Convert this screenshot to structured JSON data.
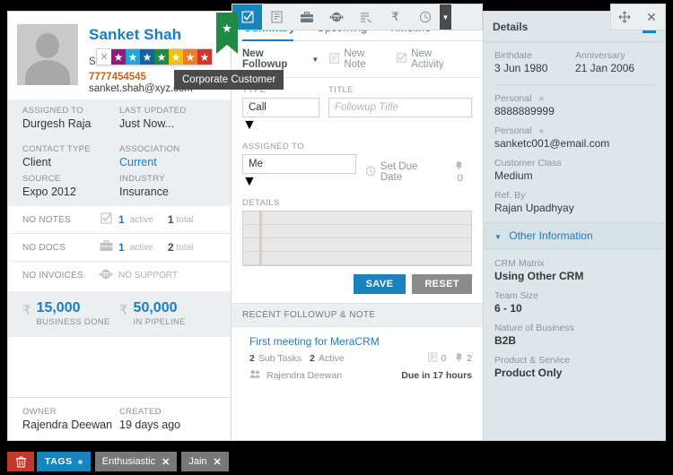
{
  "toolbar": {
    "icons": [
      {
        "name": "activity-icon",
        "glyph": "☑",
        "active": true
      },
      {
        "name": "note-icon",
        "glyph": "Ὕ2"
      },
      {
        "name": "briefcase-icon",
        "glyph": "▬"
      },
      {
        "name": "support-icon",
        "glyph": "☺"
      },
      {
        "name": "invoice-icon",
        "glyph": "≡"
      },
      {
        "name": "rupee-icon",
        "glyph": "₹"
      },
      {
        "name": "history-icon",
        "glyph": "◴"
      }
    ],
    "more_glyph": "▼",
    "move_glyph": "✥",
    "close_glyph": "✕"
  },
  "customer": {
    "name": "Sanket Shah",
    "company": "Shivam Financial Services",
    "phone": "7777454545",
    "email": "sanket.shah@xyz.com",
    "tooltip": "Corporate Customer",
    "rating_clear": "✕",
    "star_glyph": "★",
    "star_colors": [
      "#8e1c78",
      "#1ea7dd",
      "#16629e",
      "#1e8a46",
      "#f2c00f",
      "#f07c23",
      "#d4342b"
    ],
    "ribbon_color": "#1e8a46"
  },
  "left_fields": [
    {
      "label": "ASSIGNED TO",
      "value": "Durgesh Raja",
      "label2": "LAST UPDATED",
      "value2": "Just Now...",
      "band": true
    },
    {
      "label": "CONTACT TYPE",
      "value": "Client",
      "label2": "ASSOCIATION",
      "value2": "Current",
      "link2": true
    },
    {
      "label": "SOURCE",
      "value": "Expo 2012",
      "label2": "INDUSTRY",
      "value2": "Insurance"
    }
  ],
  "stats": [
    {
      "label": "NO NOTES",
      "icon": "note-check-icon",
      "glyph": "☑",
      "num": "1",
      "sub": "active",
      "num2": "1",
      "sub2": "total"
    },
    {
      "label": "NO DOCS",
      "icon": "briefcase-icon",
      "glyph": "▬",
      "num": "1",
      "sub": "active",
      "num2": "2",
      "sub2": "total"
    },
    {
      "label": "NO INVOICES",
      "icon": "support-face-icon",
      "glyph": "☺",
      "num": "",
      "sub": "NO SUPPORT",
      "num2": "",
      "sub2": ""
    }
  ],
  "money": [
    {
      "currency": "₹",
      "amount": "15,000",
      "label": "BUSINESS DONE"
    },
    {
      "currency": "₹",
      "amount": "50,000",
      "label": "IN PIPELINE"
    }
  ],
  "owner": {
    "label": "OWNER",
    "value": "Rajendra Deewan",
    "label2": "CREATED",
    "value2": "19 days ago"
  },
  "tabs": [
    {
      "label": "Summary",
      "selected": true
    },
    {
      "label": "Upcoming",
      "selected": false
    },
    {
      "label": "Timeline",
      "selected": false
    }
  ],
  "actions": [
    {
      "label": "New Followup",
      "glyph": "",
      "caret": "▼",
      "strong": true
    },
    {
      "label": "New Note",
      "glyph": "Ὕ2",
      "caret": "",
      "strong": false
    },
    {
      "label": "New Activity",
      "glyph": "☑",
      "caret": "",
      "strong": false
    }
  ],
  "form": {
    "type_label": "TYPE",
    "type_value": "Call",
    "title_label": "TITLE",
    "title_placeholder": "Followup Title",
    "assigned_label": "ASSIGNED TO",
    "assigned_value": "Me",
    "due_date_label": "Set Due Date",
    "clock_glyph": "◴",
    "bell_glyph": "ὑ4",
    "bell_count": "0",
    "details_label": "DETAILS",
    "save_label": "SAVE",
    "reset_label": "RESET",
    "arrow_glyph": "▼"
  },
  "recent": {
    "header": "RECENT FOLLOWUP & NOTE",
    "title": "First meeting for MeraCRM",
    "subtask_count": "2",
    "subtask_label": "Sub Tasks",
    "active_count": "2",
    "active_label": "Active",
    "note_icon_count": "0",
    "bell_icon_count": "2",
    "user": "Rajendra Deewan",
    "due": "Due in 17 hours"
  },
  "details_panel": {
    "title": "Details",
    "add_glyph": "+",
    "pairs": [
      {
        "label": "Birthdate",
        "value": "3 Jun 1980",
        "label2": "Anniversary",
        "value2": "21 Jan 2006"
      }
    ],
    "fields": [
      {
        "label": "Personal",
        "value": "8888889999",
        "star": true
      },
      {
        "label": "Personal",
        "value": "sanketc001@email.com",
        "star": true
      },
      {
        "label": "Customer Class",
        "value": "Medium",
        "star": false
      },
      {
        "label": "Ref. By",
        "value": "Rajan Upadhyay",
        "star": false
      }
    ],
    "other_label": "Other Information",
    "other_caret": "▼",
    "other_fields": [
      {
        "label": "CRM Matrix",
        "value": "Using Other CRM"
      },
      {
        "label": "Team Size",
        "value": "6 - 10"
      },
      {
        "label": "Nature of Business",
        "value": "B2B"
      },
      {
        "label": "Product & Service",
        "value": "Product Only"
      }
    ]
  },
  "tagbar": {
    "trash_glyph": "Ὕ1",
    "tags_label": "TAGS",
    "chips": [
      {
        "label": "Enthusiastic",
        "close": "✕"
      },
      {
        "label": "Jain",
        "close": "✕"
      }
    ]
  }
}
